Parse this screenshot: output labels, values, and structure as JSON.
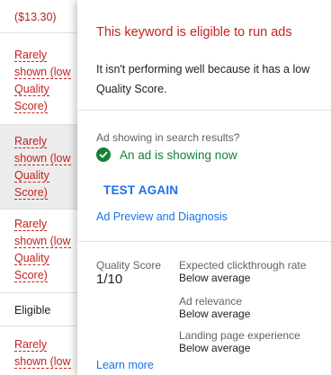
{
  "left_column": {
    "top_value": "($13.30)",
    "rows": [
      {
        "lines": [
          "Rarely",
          "shown (low",
          "Quality",
          "Score)"
        ]
      },
      {
        "lines": [
          "Rarely",
          "shown (low",
          "Quality",
          "Score)"
        ]
      },
      {
        "lines": [
          "Rarely",
          "shown (low",
          "Quality",
          "Score)"
        ]
      },
      {
        "lines": [
          "Eligible"
        ]
      },
      {
        "lines": [
          "Rarely",
          "shown (low"
        ]
      }
    ]
  },
  "panel": {
    "title": "This keyword is eligible to run ads",
    "description": "It isn't performing well because it has a low Quality Score.",
    "ad_question": "Ad showing in search results?",
    "ad_status": "An ad is showing now",
    "test_again_label": "TEST AGAIN",
    "preview_link": "Ad Preview and Diagnosis",
    "quality_score_label": "Quality Score",
    "quality_score_value": "1/10",
    "metrics": [
      {
        "label": "Expected clickthrough rate",
        "value": "Below average"
      },
      {
        "label": "Ad relevance",
        "value": "Below average"
      },
      {
        "label": "Landing page experience",
        "value": "Below average"
      }
    ],
    "learn_more": "Learn more"
  },
  "colors": {
    "warning_red": "#c5221f",
    "success_green": "#188038",
    "link_blue": "#1a73e8"
  }
}
